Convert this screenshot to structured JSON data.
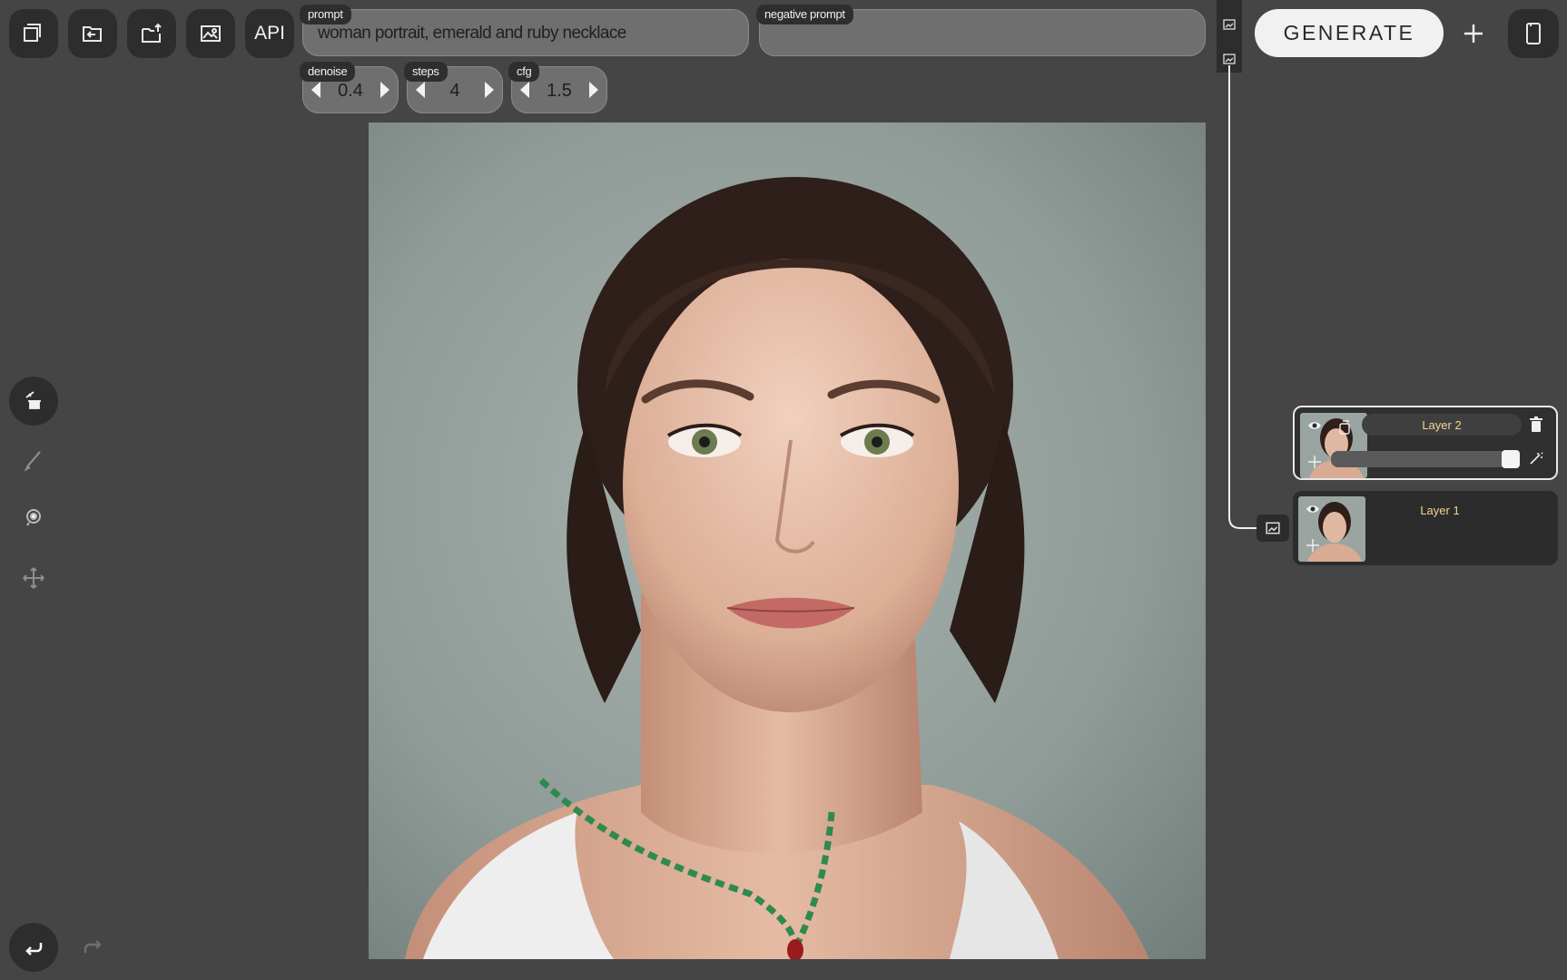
{
  "toolbar": {
    "buttons": [
      {
        "icon": "new-canvas-icon"
      },
      {
        "icon": "open-file-icon"
      },
      {
        "icon": "export-icon"
      },
      {
        "icon": "image-settings-icon"
      }
    ],
    "api_label": "API",
    "generate_label": "GENERATE",
    "add_icon": "plus-icon",
    "device_icon": "tablet-icon"
  },
  "prompt": {
    "label": "prompt",
    "value": "woman portrait, emerald and ruby necklace"
  },
  "negative_prompt": {
    "label": "negative prompt",
    "value": ""
  },
  "params": {
    "denoise": {
      "label": "denoise",
      "value": "0.4"
    },
    "steps": {
      "label": "steps",
      "value": "4"
    },
    "cfg": {
      "label": "cfg",
      "value": "1.5"
    }
  },
  "tools": [
    {
      "icon": "magic-eraser-icon",
      "active": true
    },
    {
      "icon": "brush-icon",
      "active": false
    },
    {
      "icon": "lasso-select-icon",
      "active": false
    },
    {
      "icon": "move-icon",
      "active": false
    }
  ],
  "history": {
    "undo_icon": "undo-icon",
    "redo_icon": "redo-icon"
  },
  "layers": [
    {
      "name": "Layer 2",
      "selected": true,
      "opacity": 1.0
    },
    {
      "name": "Layer 1",
      "selected": false
    }
  ],
  "colors": {
    "background": "#454545",
    "panel": "#2d2d2d",
    "layer_name": "#f4d58f",
    "field": "#6f6f6f"
  }
}
